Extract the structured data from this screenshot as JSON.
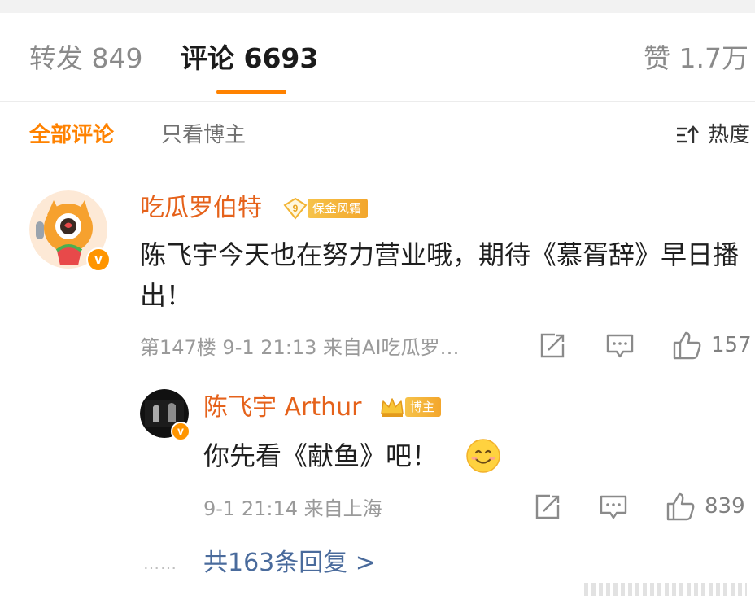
{
  "tabs": {
    "repost": "转发 849",
    "comments": "评论 6693",
    "likes": "赞 1.7万"
  },
  "filters": {
    "all": "全部评论",
    "owner_only": "只看博主",
    "sort": "热度"
  },
  "comment": {
    "author": "吃瓜罗伯特",
    "badge_level": "9",
    "badge_label": "保金风霜",
    "text": "陈飞宇今天也在努力营业哦，期待《慕胥辞》早日播出！",
    "meta": "第147楼 9-1 21:13 来自AI吃瓜罗…",
    "like_count": "157",
    "verified_mark": "v"
  },
  "reply": {
    "author": "陈飞宇 Arthur",
    "badge_label": "博主",
    "text": "你先看《献鱼》吧！",
    "meta": "9-1 21:14 来自上海",
    "like_count": "839",
    "verified_mark": "v"
  },
  "replies_link": {
    "dots": "……",
    "label": "共163条回复 >"
  },
  "colors": {
    "accent_orange": "#ff8200",
    "name_orange": "#e5621b",
    "link_blue": "#4a6b9c",
    "meta_gray": "#9a9a9a"
  },
  "icons": [
    "share-icon",
    "comment-icon",
    "like-icon",
    "sort-icon",
    "smile-emoji-icon"
  ]
}
